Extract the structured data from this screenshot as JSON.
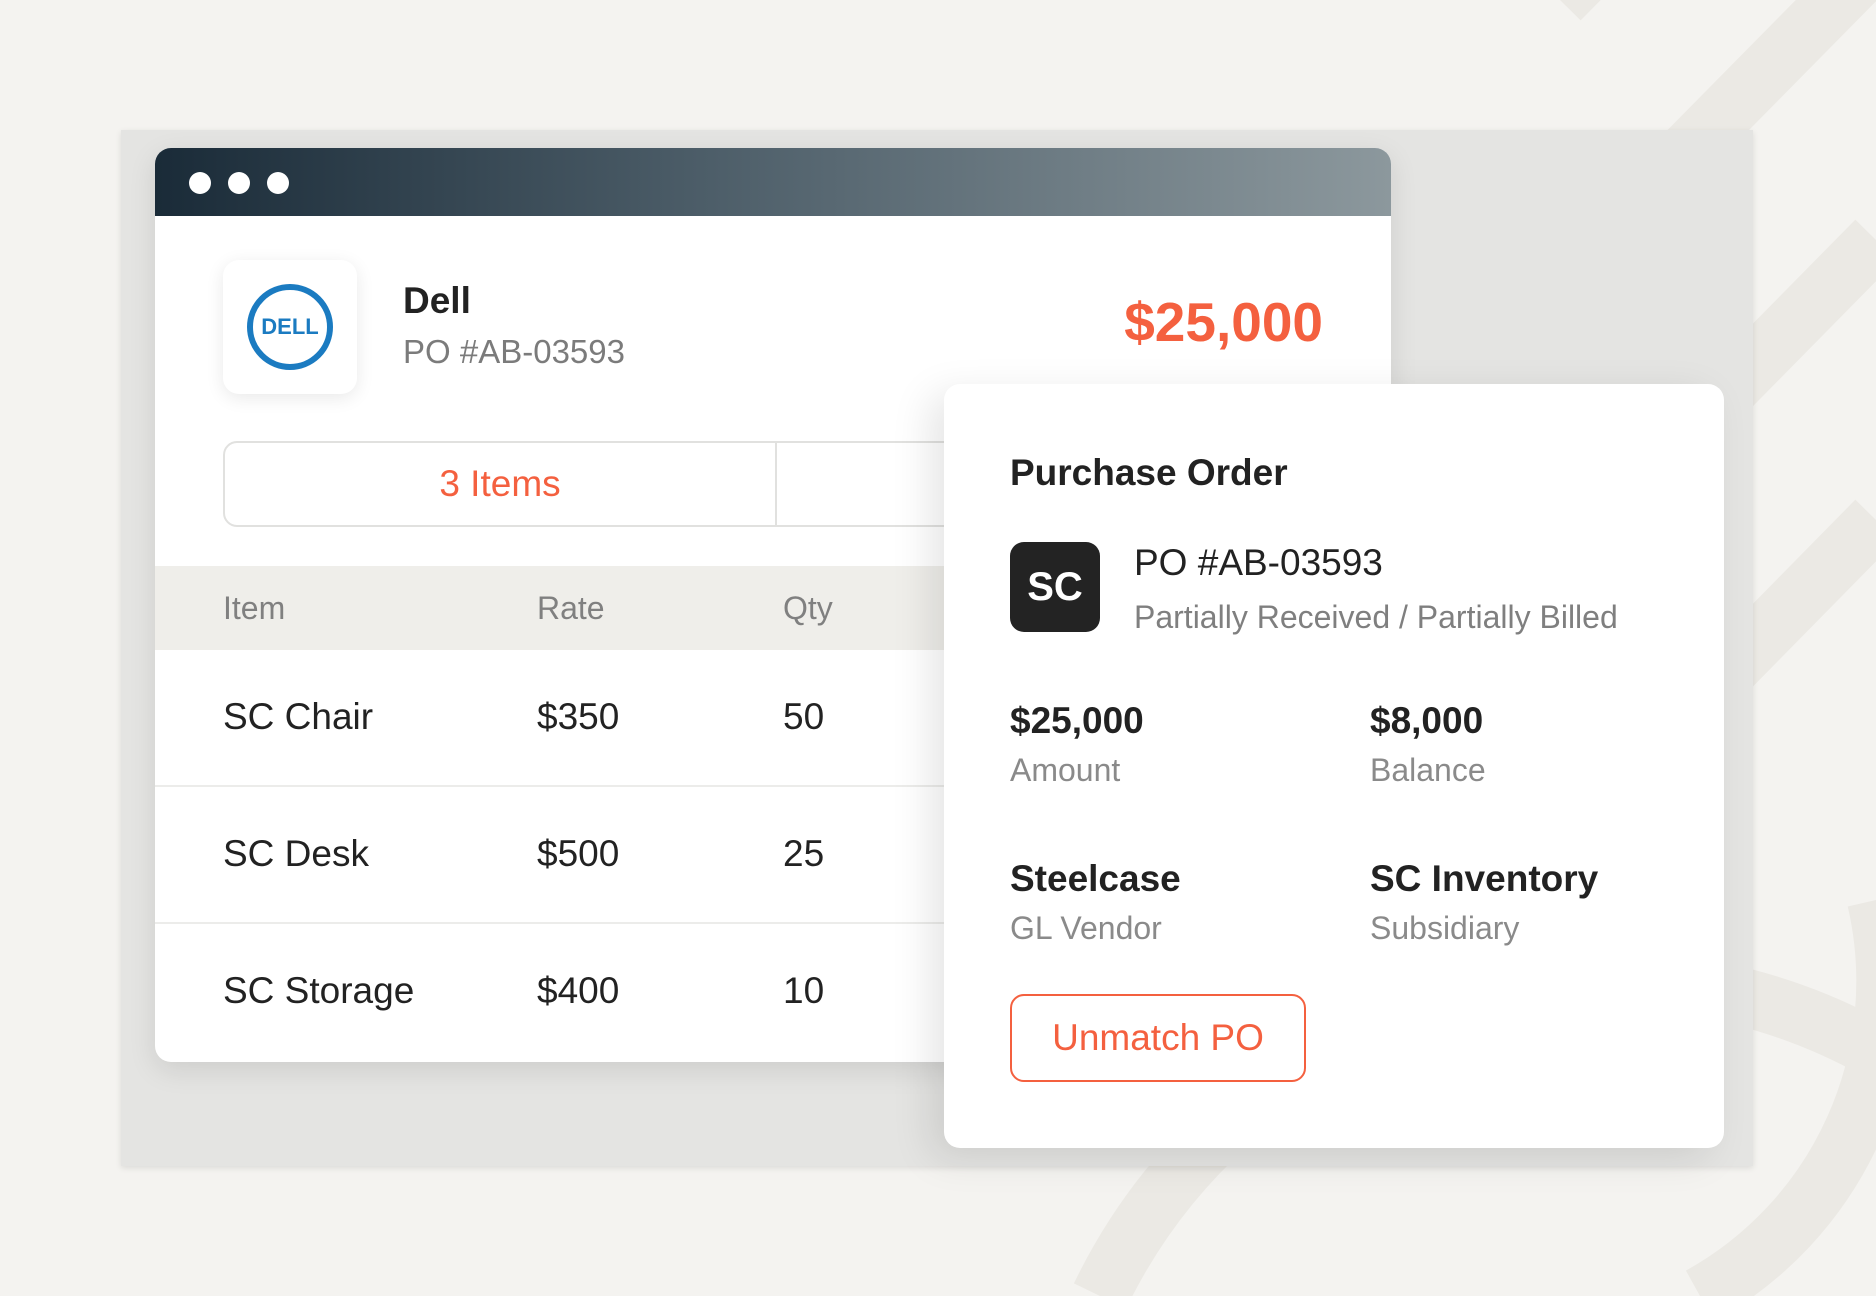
{
  "vendor": {
    "name": "Dell",
    "logo_text": "DELL",
    "po_number": "PO #AB-03593",
    "total": "$25,000"
  },
  "tabs": [
    {
      "label": "3 Items"
    }
  ],
  "table": {
    "headers": [
      "Item",
      "Rate",
      "Qty"
    ],
    "rows": [
      {
        "item": "SC Chair",
        "rate": "$350",
        "qty": "50"
      },
      {
        "item": "SC Desk",
        "rate": "$500",
        "qty": "25"
      },
      {
        "item": "SC Storage",
        "rate": "$400",
        "qty": "10"
      }
    ]
  },
  "po_card": {
    "heading": "Purchase Order",
    "badge": "SC",
    "po_number": "PO #AB-03593",
    "status": "Partially Received / Partially Billed",
    "amount": {
      "value": "$25,000",
      "label": "Amount"
    },
    "balance": {
      "value": "$8,000",
      "label": "Balance"
    },
    "vendor": {
      "value": "Steelcase",
      "label": "GL Vendor"
    },
    "subsidiary": {
      "value": "SC Inventory",
      "label": "Subsidiary"
    },
    "button_label": "Unmatch PO"
  },
  "colors": {
    "accent": "#f4603f",
    "dell_blue": "#1b7bc1",
    "titlebar_dark": "#1a2b38",
    "text_dark": "#222222"
  }
}
